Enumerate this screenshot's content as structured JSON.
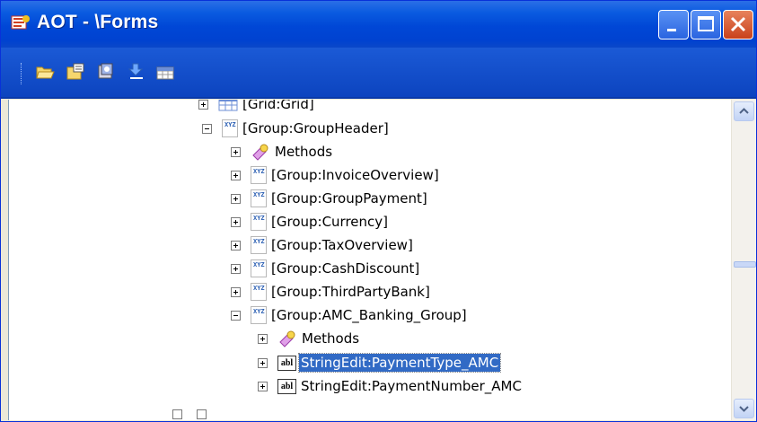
{
  "window": {
    "title": "AOT - \\Forms",
    "colors": {
      "titlebar": "#0a5be0",
      "selection": "#316ac5",
      "close_button": "#d5532b"
    }
  },
  "toolbar": {
    "items": [
      {
        "icon": "open-icon"
      },
      {
        "icon": "properties-icon"
      },
      {
        "icon": "compile-icon"
      },
      {
        "icon": "import-icon"
      },
      {
        "icon": "grid-icon"
      }
    ]
  },
  "tree": {
    "rows": [
      {
        "label": "[Grid:Grid]",
        "icon": "grid-icon",
        "expander": "plus"
      },
      {
        "label": "[Group:GroupHeader]",
        "icon": "group-icon",
        "expander": "minus"
      },
      {
        "label": "Methods",
        "icon": "methods-icon",
        "expander": "plus"
      },
      {
        "label": "[Group:InvoiceOverview]",
        "icon": "group-icon",
        "expander": "plus"
      },
      {
        "label": "[Group:GroupPayment]",
        "icon": "group-icon",
        "expander": "plus"
      },
      {
        "label": "[Group:Currency]",
        "icon": "group-icon",
        "expander": "plus"
      },
      {
        "label": "[Group:TaxOverview]",
        "icon": "group-icon",
        "expander": "plus"
      },
      {
        "label": "[Group:CashDiscount]",
        "icon": "group-icon",
        "expander": "plus"
      },
      {
        "label": "[Group:ThirdPartyBank]",
        "icon": "group-icon",
        "expander": "plus"
      },
      {
        "label": "[Group:AMC_Banking_Group]",
        "icon": "group-icon",
        "expander": "minus"
      },
      {
        "label": "Methods",
        "icon": "methods-icon",
        "expander": "plus"
      },
      {
        "label": "StringEdit:PaymentType_AMC",
        "icon": "stringedit-icon",
        "expander": "plus",
        "selected": true
      },
      {
        "label": "StringEdit:PaymentNumber_AMC",
        "icon": "stringedit-icon",
        "expander": "plus"
      }
    ],
    "group_icon_text": "XYZ",
    "stringedit_icon_text": "abl"
  }
}
